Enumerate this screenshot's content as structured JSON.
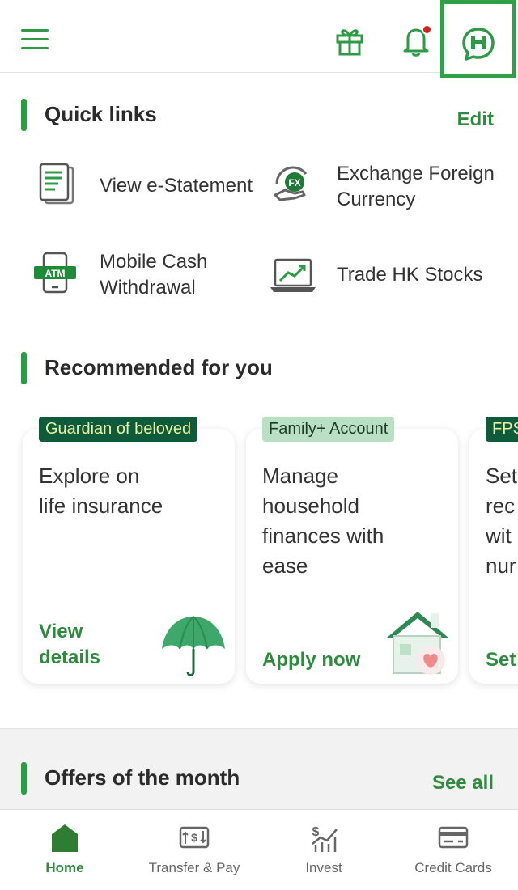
{
  "header": {
    "menu_icon": "hamburger-menu-icon",
    "gift_icon": "gift-icon",
    "notifications_icon": "bell-icon",
    "chat_icon": "chat-bubble-icon",
    "accent": "#2e9a45",
    "notification_dot_color": "#d32020"
  },
  "quick_links": {
    "title": "Quick links",
    "edit_label": "Edit",
    "items": [
      {
        "label": "View e-Statement",
        "icon": "document-icon"
      },
      {
        "label": "Exchange Foreign\nCurrency",
        "icon": "fx-exchange-icon"
      },
      {
        "label": "Mobile Cash\nWithdrawal",
        "icon": "atm-phone-icon"
      },
      {
        "label": "Trade HK Stocks",
        "icon": "stock-chart-laptop-icon"
      }
    ]
  },
  "recommended": {
    "title": "Recommended for you",
    "cards": [
      {
        "badge": "Guardian of beloved",
        "title": "Explore on\nlife insurance",
        "cta": "View\ndetails",
        "icon": "umbrella-icon"
      },
      {
        "badge": "Family+ Account",
        "title": "Manage\nhousehold\nfinances with\nease",
        "cta": "Apply now",
        "icon": "house-heart-icon"
      },
      {
        "badge": "FPS",
        "title": "Set\nrec\nwit\nnur",
        "cta": "Set"
      }
    ]
  },
  "offers": {
    "title": "Offers of the month",
    "see_all_label": "See all"
  },
  "bottom_nav": {
    "items": [
      {
        "label": "Home",
        "icon": "home-icon",
        "active": true
      },
      {
        "label": "Transfer & Pay",
        "icon": "transfer-pay-icon",
        "active": false
      },
      {
        "label": "Invest",
        "icon": "invest-icon",
        "active": false
      },
      {
        "label": "Credit Cards",
        "icon": "credit-card-icon",
        "active": false
      }
    ]
  }
}
